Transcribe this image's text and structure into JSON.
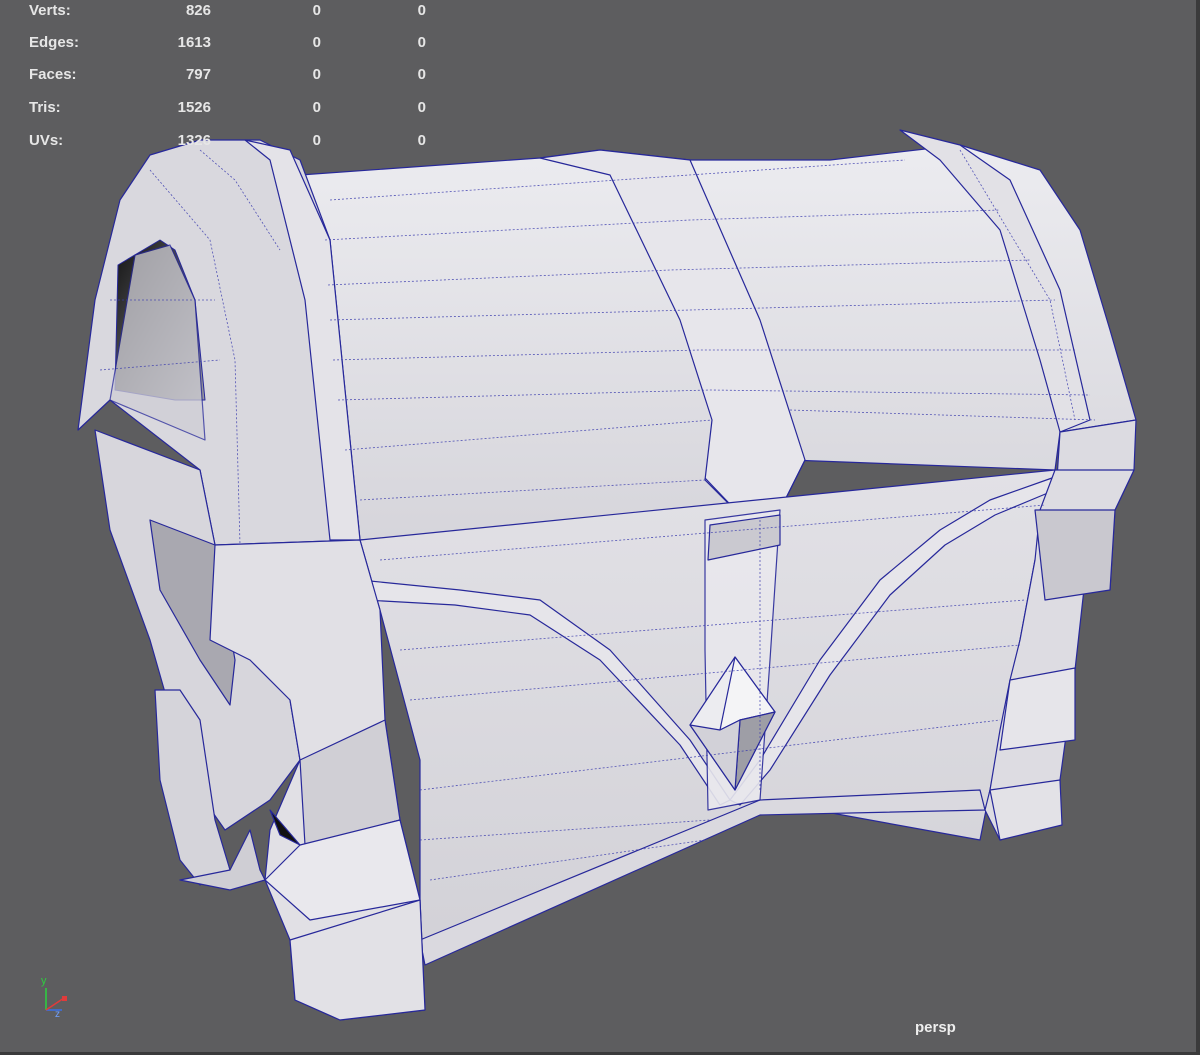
{
  "hud": {
    "rows": [
      {
        "label": "Verts:",
        "v1": "826",
        "v2": "0",
        "v3": "0"
      },
      {
        "label": "Edges:",
        "v1": "1613",
        "v2": "0",
        "v3": "0"
      },
      {
        "label": "Faces:",
        "v1": "797",
        "v2": "0",
        "v3": "0"
      },
      {
        "label": "Tris:",
        "v1": "1526",
        "v2": "0",
        "v3": "0"
      },
      {
        "label": "UVs:",
        "v1": "1326",
        "v2": "0",
        "v3": "0"
      }
    ]
  },
  "viewport": {
    "camera": "persp",
    "axis": {
      "y": "y",
      "z": "z"
    }
  },
  "colors": {
    "background": "#5d5d5f",
    "mesh_fill": "#dedde2",
    "wire": "#27289a",
    "hud_text": "#e6e6e6"
  }
}
